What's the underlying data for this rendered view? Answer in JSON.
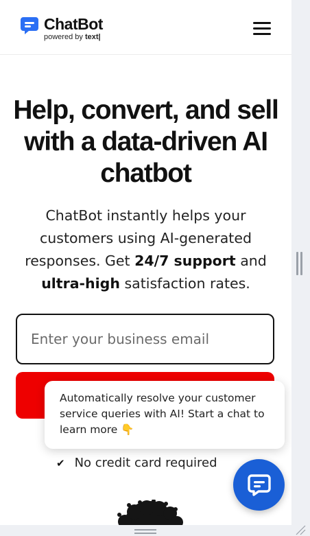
{
  "header": {
    "brand": "ChatBot",
    "powered_prefix": "powered by ",
    "powered_brand": "text|"
  },
  "hero": {
    "title": "Help, convert, and sell with a data-driven AI chatbot",
    "sub_1": "ChatBot instantly helps your customers using AI-generated responses. Get ",
    "sub_bold_1": "24/7 support",
    "sub_2": " and ",
    "sub_bold_2": "ultra-high",
    "sub_3": " satisfaction rates."
  },
  "form": {
    "email_placeholder": "Enter your business email",
    "email_value": ""
  },
  "nocard": {
    "check": "✔",
    "text": "No credit card required"
  },
  "popup": {
    "text": "Automatically resolve your customer service queries with AI! Start a chat to learn more 👇"
  },
  "colors": {
    "accent_red": "#ee0000",
    "chat_blue": "#1a5fd6",
    "logo_blue": "#2b6ff4"
  }
}
